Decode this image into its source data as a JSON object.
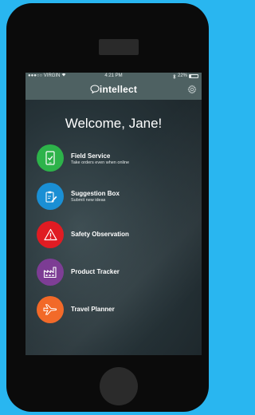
{
  "status": {
    "carrier": "●●●○○ VIRGIN",
    "time": "4:21 PM",
    "battery": "22%",
    "battery_level": 0.22
  },
  "header": {
    "logo_text": "intellect"
  },
  "welcome": "Welcome, Jane!",
  "apps": [
    {
      "title": "Field Service",
      "subtitle": "Take orders even when online",
      "color": "#2db34a",
      "icon": "tablet-check-icon"
    },
    {
      "title": "Suggestion Box",
      "subtitle": "Submit new ideas",
      "color": "#1a8fd4",
      "icon": "clipboard-pencil-icon"
    },
    {
      "title": "Safety Observation",
      "subtitle": "",
      "color": "#e01b22",
      "icon": "warning-triangle-icon"
    },
    {
      "title": "Product Tracker",
      "subtitle": "",
      "color": "#7b3a93",
      "icon": "factory-icon"
    },
    {
      "title": "Travel Planner",
      "subtitle": "",
      "color": "#f26522",
      "icon": "airplane-icon"
    }
  ]
}
